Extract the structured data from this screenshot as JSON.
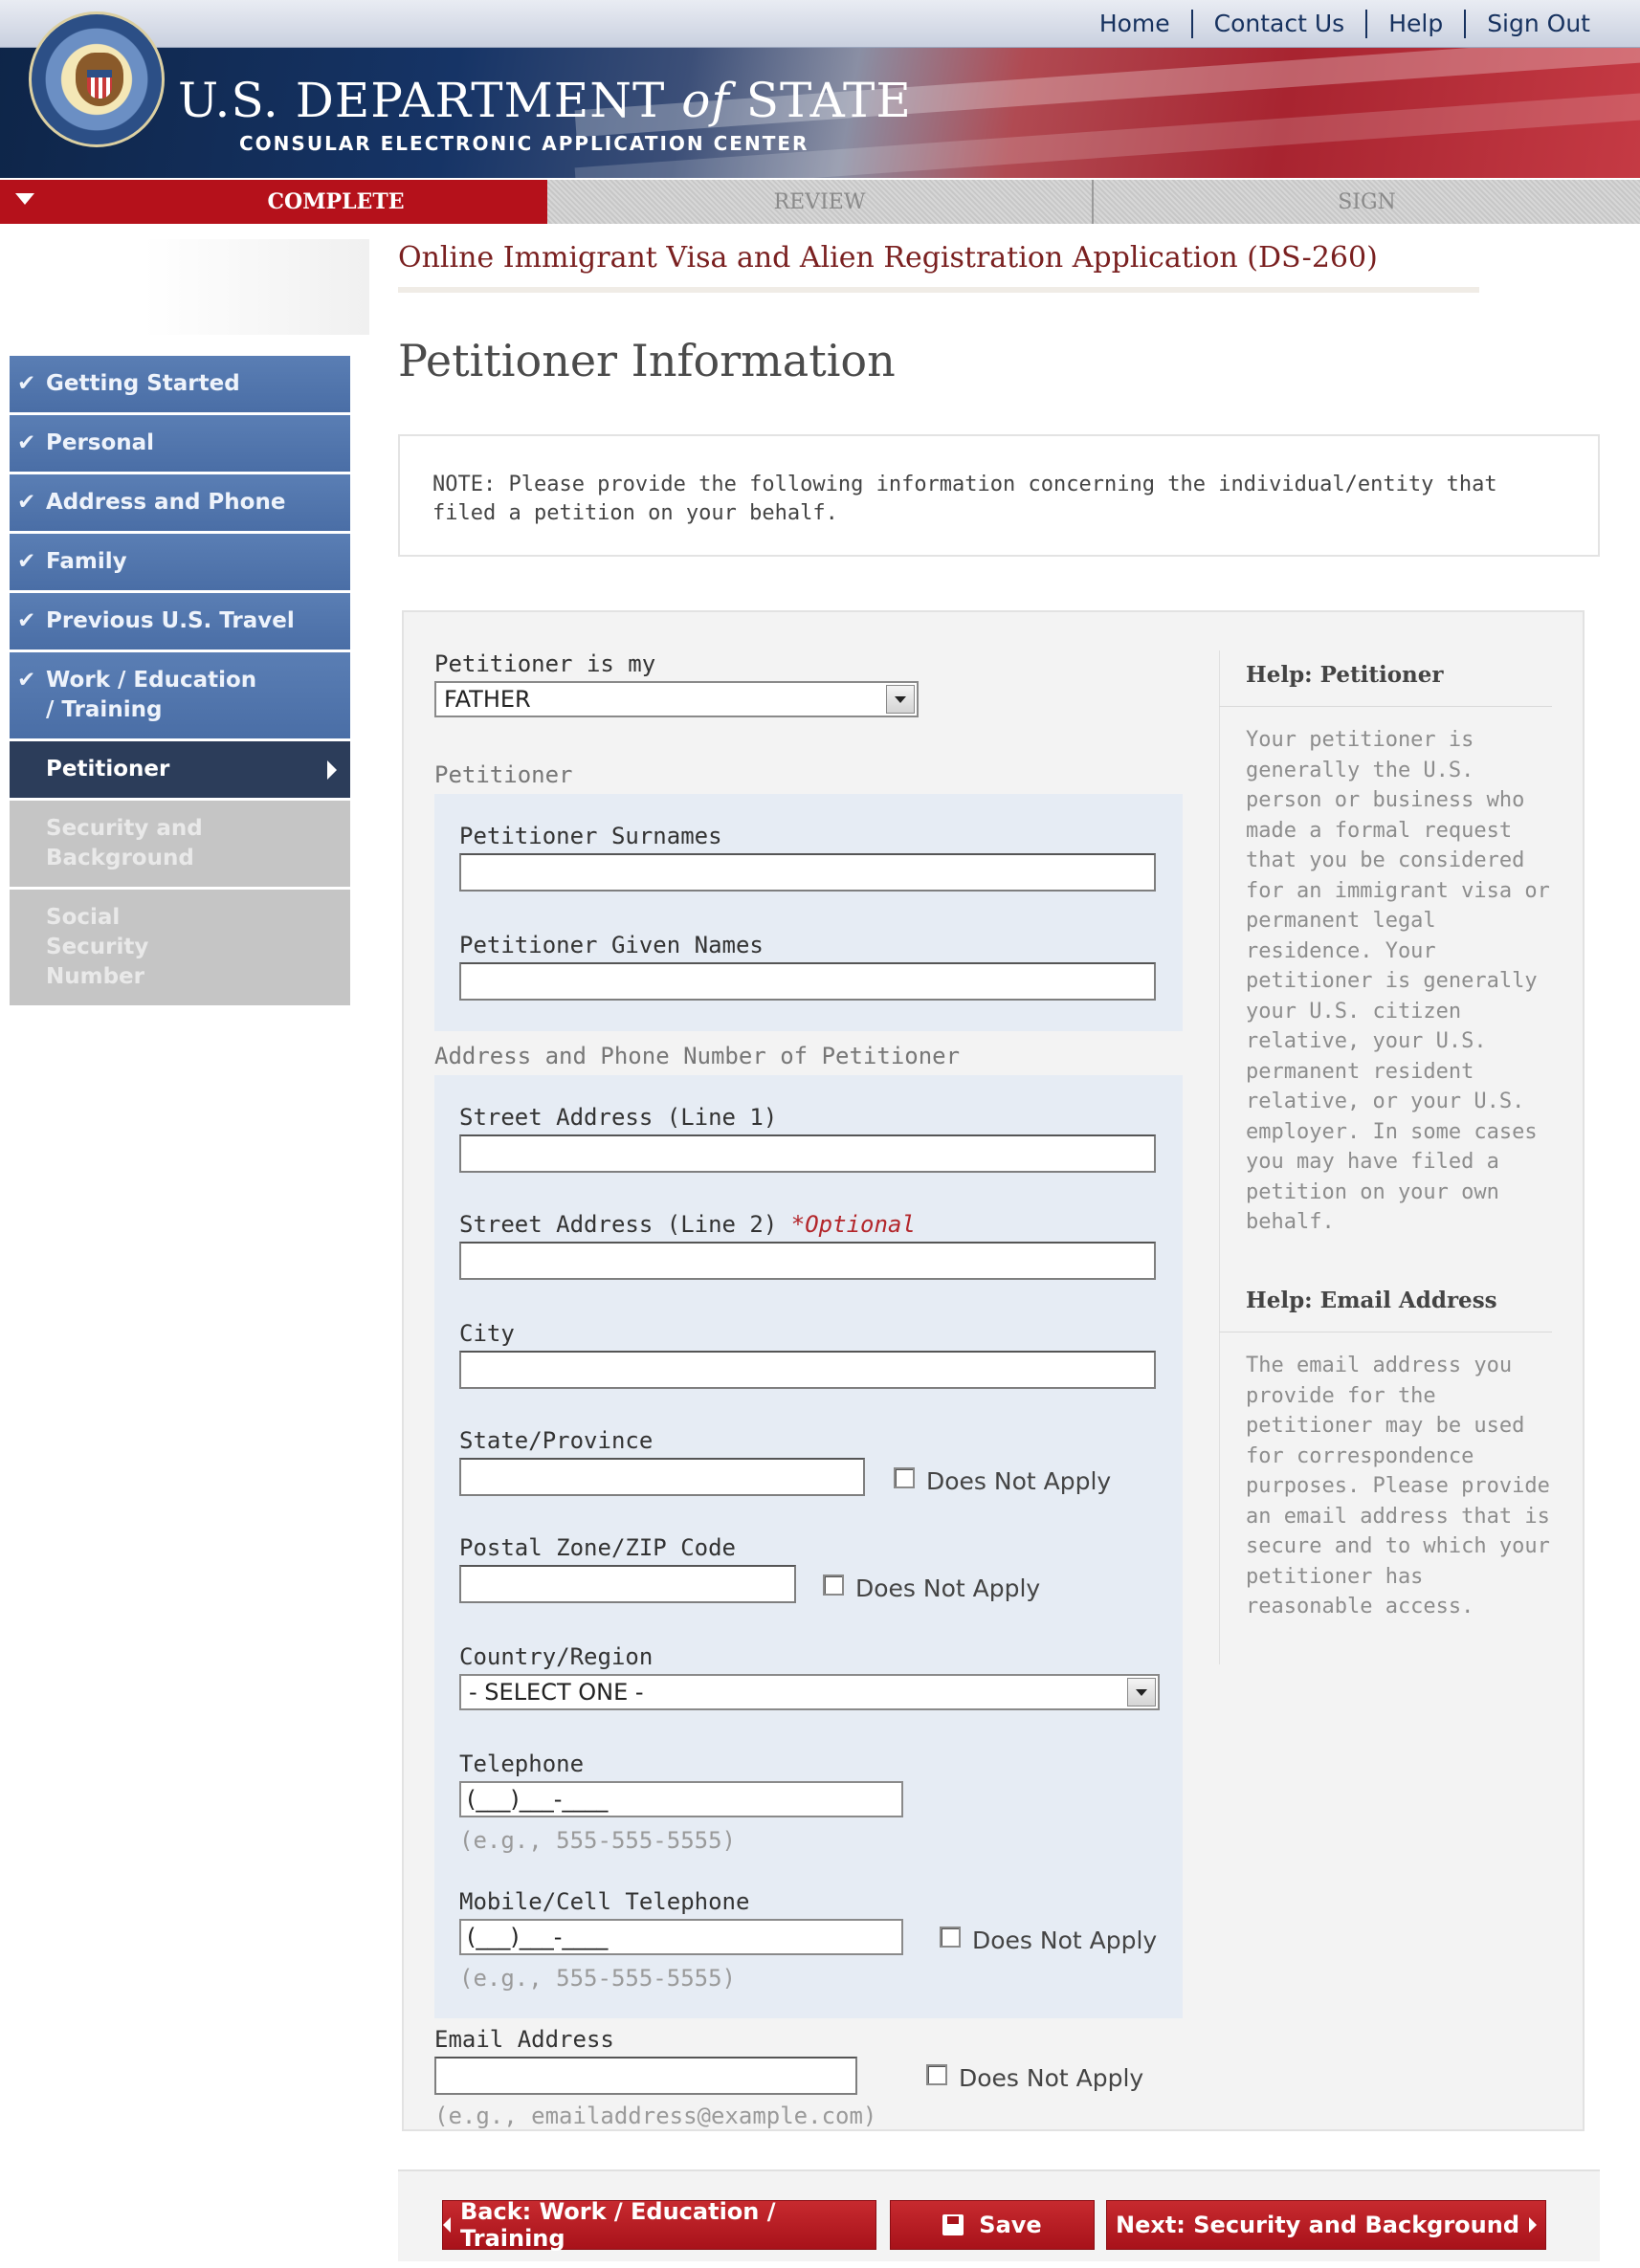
{
  "header": {
    "top_links": [
      "Home",
      "Contact Us",
      "Help",
      "Sign Out"
    ],
    "brand_title_1": "U.S. DEPARTMENT ",
    "brand_title_of": "of",
    "brand_title_2": " STATE",
    "brand_subtitle": "CONSULAR ELECTRONIC APPLICATION CENTER"
  },
  "steps": [
    "COMPLETE",
    "REVIEW",
    "SIGN"
  ],
  "app_title": "Online Immigrant Visa and Alien Registration Application (DS-260)",
  "page_title": "Petitioner Information",
  "sidebar": {
    "items": [
      {
        "label": "Getting Started",
        "state": "done"
      },
      {
        "label": "Personal",
        "state": "done"
      },
      {
        "label": "Address and Phone",
        "state": "done"
      },
      {
        "label": "Family",
        "state": "done"
      },
      {
        "label": "Previous U.S. Travel",
        "state": "done"
      },
      {
        "label": "Work / Education / Training",
        "state": "done"
      },
      {
        "label": "Petitioner",
        "state": "current"
      },
      {
        "label": "Security and Background",
        "state": "todo"
      },
      {
        "label": "Social Security Number",
        "state": "todo"
      }
    ]
  },
  "note": "NOTE: Please provide the following information concerning the individual/entity that filed a petition on your behalf.",
  "form": {
    "petitioner_is_my_label": "Petitioner is my",
    "petitioner_is_my_value": "FATHER",
    "section_petitioner": "Petitioner",
    "surnames_label": "Petitioner Surnames",
    "given_names_label": "Petitioner Given Names",
    "section_address": "Address and Phone Number of Petitioner",
    "street1_label": "Street Address (Line 1)",
    "street2_label": "Street Address (Line 2) ",
    "street2_optional": "*Optional",
    "city_label": "City",
    "state_label": "State/Province",
    "zip_label": "Postal Zone/ZIP Code",
    "country_label": "Country/Region",
    "country_value": "- SELECT ONE -",
    "telephone_label": "Telephone",
    "phone_mask": "(___)___-____",
    "phone_example": "(e.g., 555-555-5555)",
    "mobile_label": "Mobile/Cell Telephone",
    "email_label": "Email Address",
    "email_example": "(e.g., emailaddress@example.com)",
    "does_not_apply": "Does Not Apply"
  },
  "help": {
    "petitioner_title": "Help: Petitioner",
    "petitioner_text": "Your petitioner is generally the U.S. person or business who made a formal request that you be considered for an immigrant visa or permanent legal residence. Your petitioner is generally your U.S. citizen relative, your U.S. permanent resident relative, or your U.S. employer. In some cases you may have filed a petition on your own behalf.",
    "email_title": "Help: Email Address",
    "email_text": "The email address you provide for the petitioner may be used for correspondence purposes. Please provide an email address that is secure and to which your petitioner has reasonable access."
  },
  "buttons": {
    "back": "Back: Work / Education / Training",
    "save": "Save",
    "next": "Next: Security and Background"
  },
  "colors": {
    "accent_red": "#b5111b",
    "nav_done": "#4a6ea6",
    "nav_current": "#2c3d5a",
    "nav_todo": "#c5c5c5"
  }
}
